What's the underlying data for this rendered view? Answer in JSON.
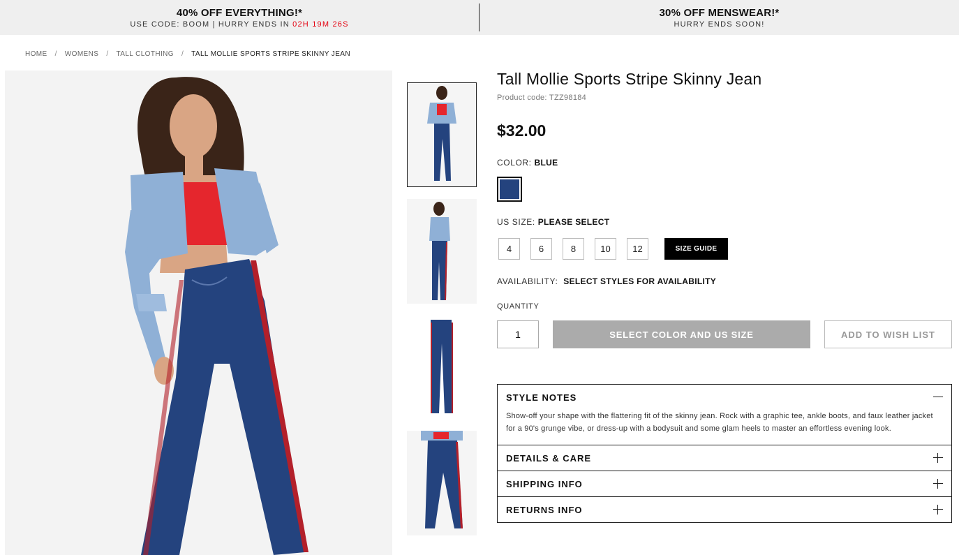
{
  "promo": {
    "left_title": "40% OFF EVERYTHING!*",
    "left_sub_prefix": "USE CODE: BOOM | HURRY ENDS IN ",
    "left_countdown": "02H 19M 26S",
    "right_title": "30% OFF MENSWEAR!*",
    "right_sub": "HURRY ENDS SOON!"
  },
  "breadcrumb": {
    "items": [
      "HOME",
      "WOMENS",
      "TALL CLOTHING",
      "TALL MOLLIE SPORTS STRIPE SKINNY JEAN"
    ],
    "separator": "/"
  },
  "product": {
    "title": "Tall Mollie Sports Stripe Skinny Jean",
    "code": "Product code: TZZ98184",
    "price": "$32.00",
    "color_label": "COLOR:",
    "color_value": "BLUE",
    "swatch_color": "#24437e",
    "size_label": "US SIZE:",
    "size_value": "PLEASE SELECT",
    "sizes": [
      "4",
      "6",
      "8",
      "10",
      "12"
    ],
    "size_guide": "SIZE GUIDE",
    "availability_label": "AVAILABILITY:",
    "availability_value": "SELECT STYLES FOR AVAILABILITY",
    "quantity_label": "QUANTITY",
    "quantity": "1",
    "add_button": "SELECT COLOR AND US SIZE",
    "wish_button": "ADD TO WISH LIST"
  },
  "accordion": {
    "style_notes_title": "STYLE NOTES",
    "style_notes_body": "Show-off your shape with the flattering fit of the skinny jean. Rock with a graphic tee, ankle boots, and faux leather jacket for a 90's grunge vibe, or dress-up with a bodysuit and some glam heels to master an effortless evening look.",
    "details_title": "DETAILS & CARE",
    "shipping_title": "SHIPPING INFO",
    "returns_title": "RETURNS INFO"
  },
  "colors": {
    "countdown": "#e4000f",
    "denim": "#24437e",
    "jacket": "#8fb0d6",
    "top": "#e5262d",
    "stripe": "#b3202a",
    "hair": "#3a2418",
    "skin": "#d9a584"
  }
}
